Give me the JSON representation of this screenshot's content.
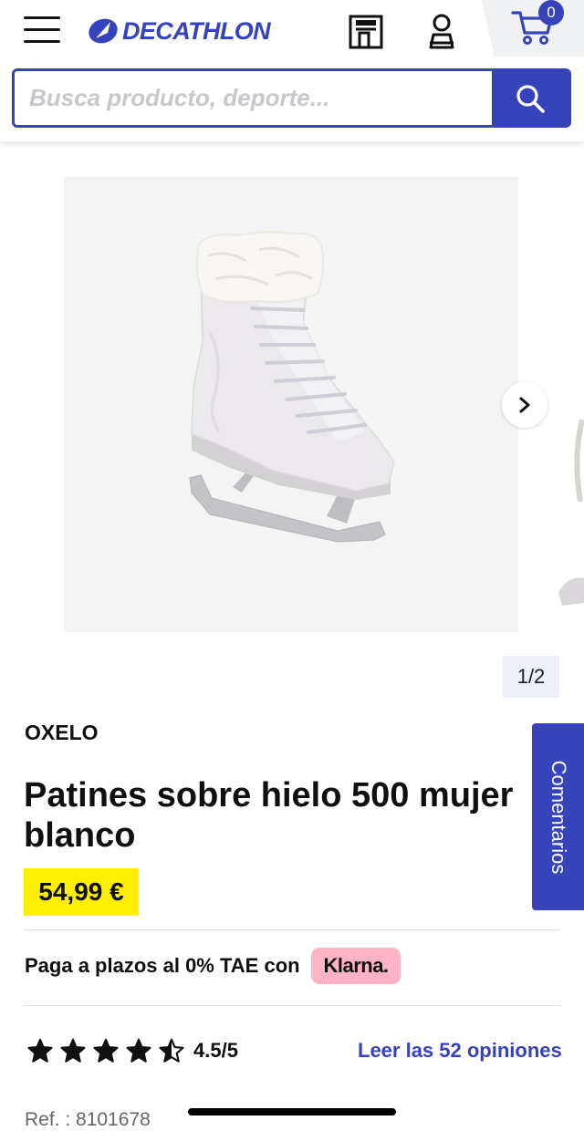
{
  "header": {
    "logo_text": "DECATHLON",
    "cart_count": "0",
    "icons": {
      "menu": "hamburger-menu-icon",
      "logo_mark": "decathlon-logo-icon",
      "store": "store-icon",
      "account": "user-icon",
      "cart": "shopping-cart-icon"
    }
  },
  "search": {
    "placeholder": "Busca producto, deporte...",
    "icon": "search-icon"
  },
  "gallery": {
    "image": "ice-skate-image",
    "counter": "1/2",
    "next_icon": "chevron-right-icon"
  },
  "product": {
    "brand": "OXELO",
    "title": "Patines sobre hielo 500 mujer blanco",
    "price": "54,99 €",
    "installments_text": "Paga a plazos al 0% TAE con",
    "klarna_label": "Klarna.",
    "rating_value": 4.5,
    "rating_text": "4.5/5",
    "reviews_link": "Leer las 52 opiniones",
    "reference": "Ref. : 8101678"
  },
  "comments_tab": {
    "label": "Comentarios"
  },
  "colors": {
    "brand_blue": "#3643ba",
    "price_yellow": "#fff000",
    "klarna_pink": "#ffb3c7"
  }
}
